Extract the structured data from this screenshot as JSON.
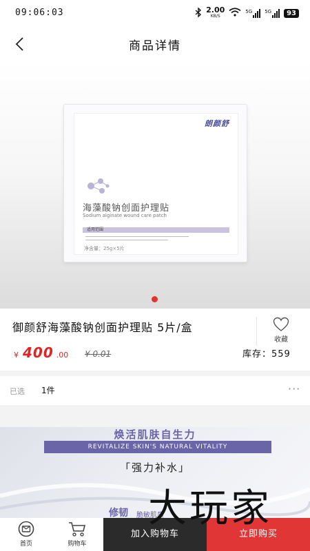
{
  "status_bar": {
    "time": "09:06:03",
    "speed_value": "2.00",
    "speed_unit": "KB/S",
    "signal1": "5G",
    "signal2": "5G",
    "battery": "93"
  },
  "header": {
    "title": "商品详情"
  },
  "product_image": {
    "brand": "朗颜舒",
    "name_cn": "海藻酸钠创面护理贴",
    "name_en": "Sodium alginate wound care patch",
    "section_label": "适用范围",
    "net_content": "净含量：25g×5片"
  },
  "product": {
    "title": "御颜舒海藻酸钠创面护理贴 5片/盒",
    "currency": "¥",
    "price_int": "400",
    "price_dec": ".00",
    "original_price": "¥ 0.01",
    "stock_label": "库存：",
    "stock_value": "559",
    "favorite_label": "收藏"
  },
  "selection": {
    "label": "已选",
    "value": "1件",
    "more": "···"
  },
  "banner": {
    "title_cn": "焕活肌肤自生力",
    "title_en": "REVITALIZE SKIN'S NATURAL VITALITY",
    "subtitle": "「强力补水」",
    "tough": "修韧",
    "tough2": "脆敏肌质"
  },
  "watermark": "大玩家",
  "bottom_bar": {
    "home_label": "首页",
    "cart_label": "购物车",
    "add_to_cart": "加入购物车",
    "buy_now": "立即购买"
  },
  "colors": {
    "accent_red": "#e02424",
    "banner_purple": "#6a64a8",
    "cart_button": "#2b2b2b"
  }
}
